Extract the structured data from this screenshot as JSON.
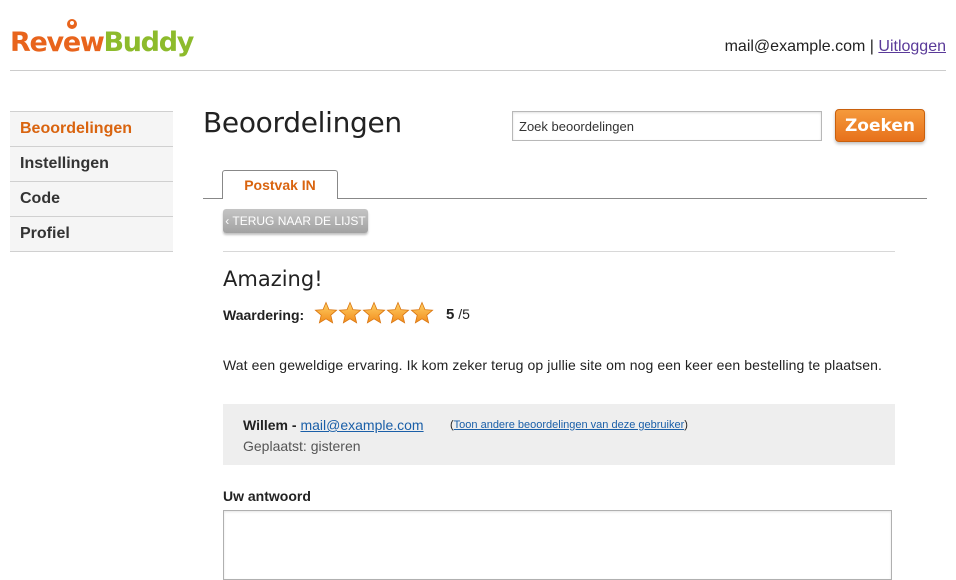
{
  "header": {
    "logo_text": "ReviewBuddy",
    "logo_part1": "Rev",
    "logo_part2": "ew",
    "logo_part3": "Buddy",
    "user_email": "mail@example.com",
    "separator": "|",
    "logout_label": "Uitloggen"
  },
  "sidebar": {
    "items": [
      {
        "label": "Beoordelingen",
        "active": true
      },
      {
        "label": "Instellingen",
        "active": false
      },
      {
        "label": "Code",
        "active": false
      },
      {
        "label": "Profiel",
        "active": false
      }
    ]
  },
  "main": {
    "title": "Beoordelingen",
    "search": {
      "placeholder": "Zoek beoordelingen",
      "button_label": "Zoeken"
    },
    "tabs": [
      {
        "label": "Postvak IN",
        "active": true
      }
    ],
    "back_button": "‹ TERUG NAAR DE LIJST"
  },
  "review": {
    "title": "Amazing!",
    "rating_label": "Waardering:",
    "rating_value": 5,
    "rating_score": "5",
    "rating_max": "/5",
    "text": "Wat een geweldige ervaring. Ik kom zeker terug op jullie site om nog een keer een bestelling te plaatsen.",
    "author_name": "Willem",
    "author_dash": " - ",
    "author_email": "mail@example.com",
    "other_reviews_open": "(",
    "other_reviews_link": "Toon andere beoordelingen van deze gebruiker",
    "other_reviews_close": ")",
    "posted": "Geplaatst: gisteren"
  },
  "answer": {
    "label": "Uw antwoord",
    "value": ""
  },
  "colors": {
    "accent": "#e8641c",
    "brand_green": "#8dbb2c",
    "link": "#1a5fa8",
    "star": "#f6a623"
  }
}
